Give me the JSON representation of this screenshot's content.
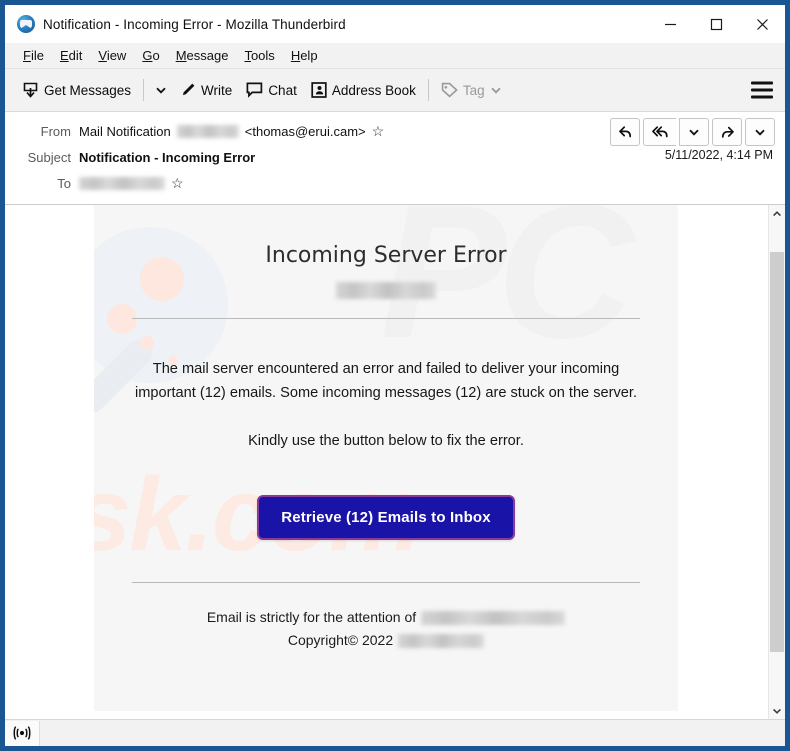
{
  "window": {
    "title": "Notification - Incoming Error - Mozilla Thunderbird",
    "logo_icon": "thunderbird-logo-icon",
    "controls": {
      "minimize": "minimize-icon",
      "maximize": "maximize-icon",
      "close": "close-icon"
    }
  },
  "menubar": {
    "items": [
      {
        "label": "File",
        "accesskey": "F"
      },
      {
        "label": "Edit",
        "accesskey": "E"
      },
      {
        "label": "View",
        "accesskey": "V"
      },
      {
        "label": "Go",
        "accesskey": "G"
      },
      {
        "label": "Message",
        "accesskey": "M"
      },
      {
        "label": "Tools",
        "accesskey": "T"
      },
      {
        "label": "Help",
        "accesskey": "H"
      }
    ]
  },
  "toolbar": {
    "get_messages_label": "Get Messages",
    "get_messages_icon": "download-inbox-icon",
    "get_messages_caret_icon": "chevron-down-icon",
    "write_label": "Write",
    "write_icon": "pencil-icon",
    "chat_label": "Chat",
    "chat_icon": "speech-bubble-icon",
    "address_book_label": "Address Book",
    "address_book_icon": "contact-card-icon",
    "tag_label": "Tag",
    "tag_icon": "tag-icon",
    "tag_caret_icon": "chevron-down-icon",
    "tag_disabled": true,
    "app_menu_icon": "hamburger-menu-icon"
  },
  "message_header": {
    "from_label": "From",
    "from_name": "Mail Notification",
    "from_redacted_width": 62,
    "from_address": "<thomas@erui.cam>",
    "from_star_icon": "star-icon",
    "subject_label": "Subject",
    "subject_value": "Notification - Incoming Error",
    "to_label": "To",
    "to_redacted_width": 86,
    "to_star_icon": "star-icon",
    "date": "5/11/2022, 4:14 PM",
    "actions": [
      {
        "name": "reply-button",
        "icon": "reply-arrow-icon"
      },
      {
        "name": "reply-all-button",
        "icon": "reply-all-arrow-icon"
      },
      {
        "name": "reply-all-dropdown",
        "icon": "chevron-down-icon"
      },
      {
        "name": "forward-button",
        "icon": "forward-arrow-icon"
      },
      {
        "name": "more-actions-dropdown",
        "icon": "chevron-down-icon"
      }
    ]
  },
  "email": {
    "title": "Incoming Server Error",
    "domain_redacted_width": 100,
    "paragraph_1": "The mail server encountered an error and failed to deliver your incoming important (12) emails. Some incoming messages (12) are stuck on the server.",
    "paragraph_2": "Kindly use the button below to fix the error.",
    "cta_label": "Retrieve (12) Emails to Inbox",
    "cta_bg_color": "#1a13a8",
    "cta_border_color": "#8a3a9a",
    "cta_text_color": "#ffffff",
    "footer_attention_text": "Email is strictly for the attention of",
    "footer_attention_redacted_width": 144,
    "footer_copyright_text": "Copyright© 2022",
    "footer_copyright_redacted_width": 86,
    "watermark_primary": "risk.com",
    "watermark_secondary": "PC",
    "watermark_color": "#fdeae2",
    "card_bg_color": "#f6f6f6"
  },
  "scrollbar": {
    "up_arrow_icon": "chevron-up-icon",
    "down_arrow_icon": "chevron-down-icon"
  },
  "statusbar": {
    "icon": "broadcast-rss-icon",
    "text": ""
  }
}
